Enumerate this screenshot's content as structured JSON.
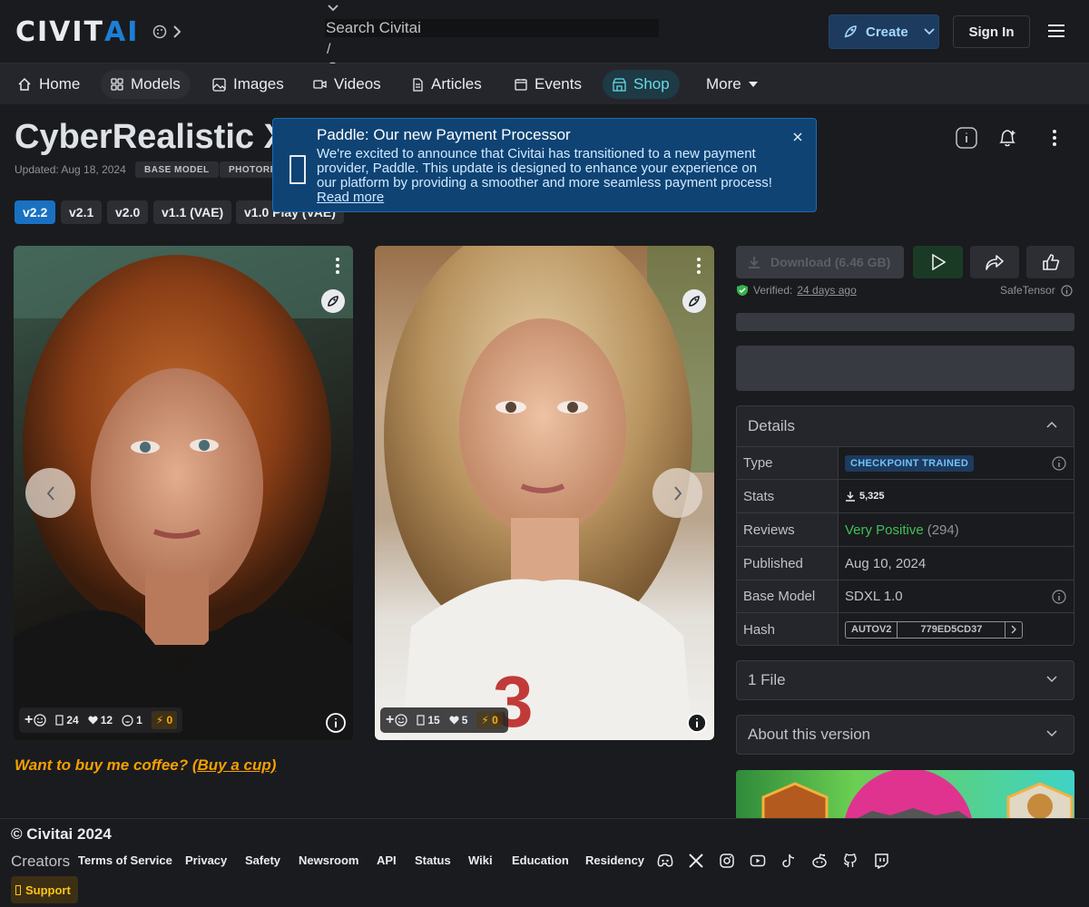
{
  "header": {
    "logo_part1": "CIVIT",
    "logo_part2": "AI",
    "search_placeholder": "Search Civitai",
    "search_shortcut": "/",
    "create_label": "Create",
    "signin_label": "Sign In"
  },
  "nav": {
    "items": [
      {
        "label": "Home"
      },
      {
        "label": "Models"
      },
      {
        "label": "Images"
      },
      {
        "label": "Videos"
      },
      {
        "label": "Articles"
      },
      {
        "label": "Events"
      },
      {
        "label": "Shop"
      },
      {
        "label": "More"
      }
    ]
  },
  "model": {
    "title": "CyberRealistic XL",
    "updated": "Updated: Aug 18, 2024",
    "badges": [
      "BASE MODEL",
      "PHOTORE"
    ],
    "versions": [
      "v2.2",
      "v2.1",
      "v2.0",
      "v1.1 (VAE)",
      "v1.0 Play (VAE)"
    ],
    "active_version": "v2.2"
  },
  "notice": {
    "title": "Paddle: Our new Payment Processor",
    "body": "We're excited to announce that Civitai has transitioned to a new payment provider, Paddle. This update is designed to enhance your experience on our platform by providing a smoother and more seamless payment process!",
    "link": "Read more"
  },
  "images": [
    {
      "comments": "24",
      "likes": "12",
      "laughs": "1",
      "buzz": "0"
    },
    {
      "comments": "15",
      "likes": "5",
      "buzz": "0"
    }
  ],
  "coffee": {
    "text": "Want to buy me coffee? ",
    "link": "(Buy a cup)"
  },
  "panel": {
    "download_label": "Download (6.46 GB)",
    "verified_label": "Verified:",
    "verified_when": "24 days ago",
    "safetensor": "SafeTensor"
  },
  "details": {
    "title": "Details",
    "rows": [
      {
        "key": "Type",
        "value": "CHECKPOINT TRAINED"
      },
      {
        "key": "Stats",
        "value": "5,325"
      },
      {
        "key": "Reviews",
        "value": "Very Positive",
        "count": "(294)"
      },
      {
        "key": "Published",
        "value": "Aug 10, 2024"
      },
      {
        "key": "Base Model",
        "value": "SDXL 1.0"
      },
      {
        "key": "Hash",
        "hash_type": "AUTOV2",
        "hash_value": "779ED5CD37"
      }
    ]
  },
  "accordions": {
    "files": "1 File",
    "about": "About this version"
  },
  "footer": {
    "copyright": "© Civitai 2024",
    "creators": "Creators",
    "links": [
      "Terms of Service",
      "Privacy",
      "Safety",
      "Newsroom",
      "API",
      "Status",
      "Wiki",
      "Education",
      "Residency"
    ],
    "support": "Support",
    "social_icons": [
      "discord-icon",
      "x-icon",
      "instagram-icon",
      "youtube-icon",
      "tiktok-icon",
      "reddit-icon",
      "github-icon",
      "twitch-icon"
    ]
  },
  "colors": {
    "background": "#1a1b1e",
    "accent_blue": "#1971c2",
    "notice_bg": "#0f4374",
    "positive_green": "#40c057",
    "buzz_yellow": "#fab005"
  }
}
